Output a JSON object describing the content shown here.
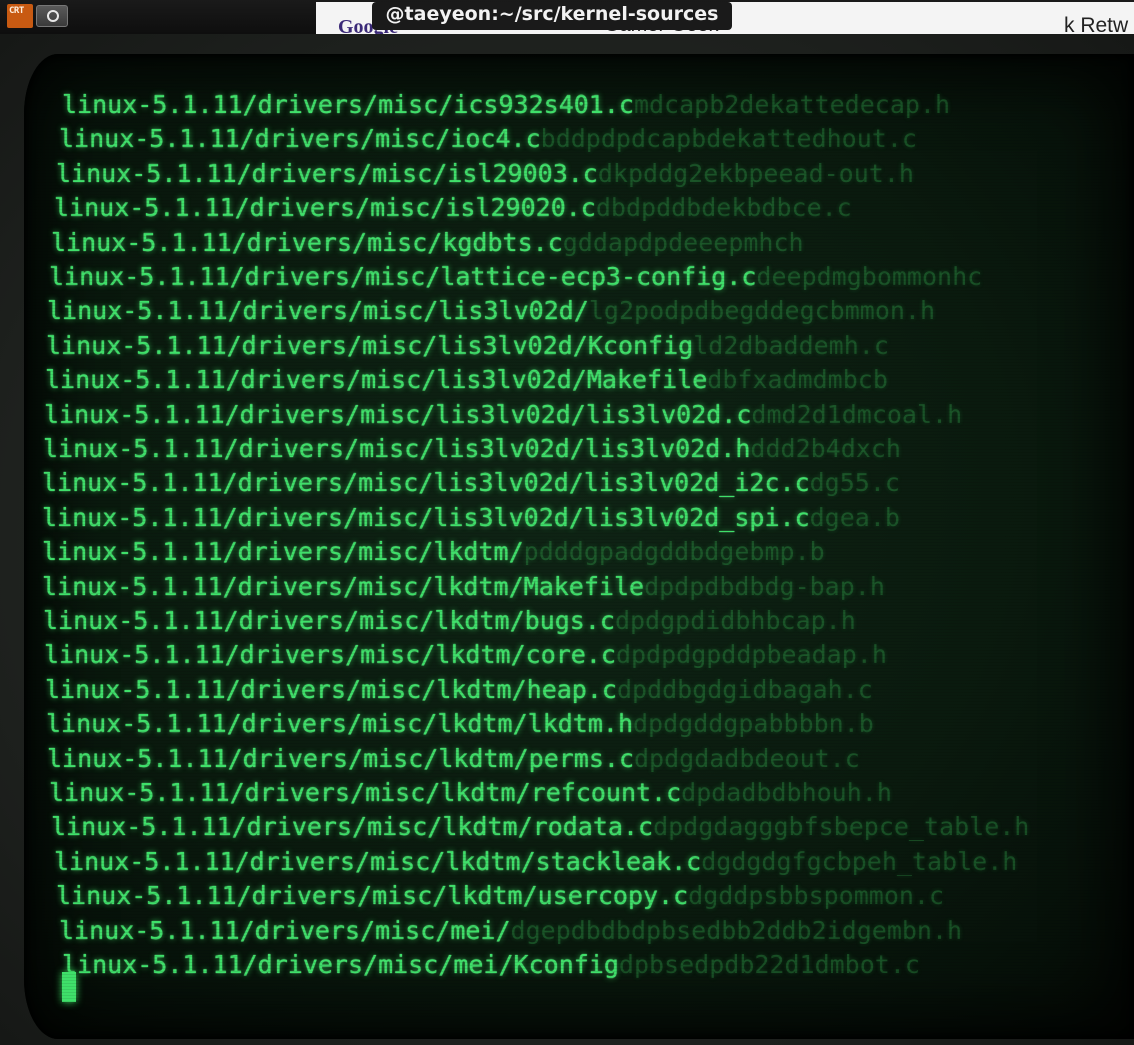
{
  "window": {
    "title": "@taeyeon:~/src/kernel-sources",
    "app_icon_label": "CRT",
    "app_icon": "crt-app-icon",
    "menu_icon": "circle-menu-icon",
    "background_window": {
      "logo_text": "Google",
      "heading_text": "Gamer Geek",
      "right_text": "k Retw"
    }
  },
  "colors": {
    "phosphor": "#3fe06a",
    "screen": "#0a1a0e",
    "titlebar": "#111111"
  },
  "terminal": {
    "lines": [
      {
        "text": "linux-5.1.11/drivers/misc/ics932s401.c",
        "ghost": "mdcapb2dekattedecap.h"
      },
      {
        "text": "linux-5.1.11/drivers/misc/ioc4.c",
        "ghost": "bddpdpdcapbdekattedhout.c"
      },
      {
        "text": "linux-5.1.11/drivers/misc/isl29003.c",
        "ghost": "dkpddg2ekbpeead-out.h"
      },
      {
        "text": "linux-5.1.11/drivers/misc/isl29020.c",
        "ghost": "dbdpddbdekbdbce.c"
      },
      {
        "text": "linux-5.1.11/drivers/misc/kgdbts.c",
        "ghost": "gddapdpdeeepmhch"
      },
      {
        "text": "linux-5.1.11/drivers/misc/lattice-ecp3-config.c",
        "ghost": "deepdmgbommonhc"
      },
      {
        "text": "linux-5.1.11/drivers/misc/lis3lv02d/",
        "ghost": "lg2podpdbegddegcbmmon.h"
      },
      {
        "text": "linux-5.1.11/drivers/misc/lis3lv02d/Kconfig",
        "ghost": "ld2dbaddemh.c"
      },
      {
        "text": "linux-5.1.11/drivers/misc/lis3lv02d/Makefile",
        "ghost": "dbfxadmdmbcb"
      },
      {
        "text": "linux-5.1.11/drivers/misc/lis3lv02d/lis3lv02d.c",
        "ghost": "dmd2d1dmcoal.h"
      },
      {
        "text": "linux-5.1.11/drivers/misc/lis3lv02d/lis3lv02d.h",
        "ghost": "ddd2b4dxch"
      },
      {
        "text": "linux-5.1.11/drivers/misc/lis3lv02d/lis3lv02d_i2c.c",
        "ghost": "dg55.c"
      },
      {
        "text": "linux-5.1.11/drivers/misc/lis3lv02d/lis3lv02d_spi.c",
        "ghost": "dgea.b"
      },
      {
        "text": "linux-5.1.11/drivers/misc/lkdtm/",
        "ghost": "pdddgpadgddbdgebmp.b"
      },
      {
        "text": "linux-5.1.11/drivers/misc/lkdtm/Makefile",
        "ghost": "dpdpdbdbdg-bap.h"
      },
      {
        "text": "linux-5.1.11/drivers/misc/lkdtm/bugs.c",
        "ghost": "dpdgpdidbhbcap.h"
      },
      {
        "text": "linux-5.1.11/drivers/misc/lkdtm/core.c",
        "ghost": "dpdpdgpddpbeadap.h"
      },
      {
        "text": "linux-5.1.11/drivers/misc/lkdtm/heap.c",
        "ghost": "dpddbgdgidbagah.c"
      },
      {
        "text": "linux-5.1.11/drivers/misc/lkdtm/lkdtm.h",
        "ghost": "dpdgddgpabbbbn.b"
      },
      {
        "text": "linux-5.1.11/drivers/misc/lkdtm/perms.c",
        "ghost": "dpdgdadbdeout.c"
      },
      {
        "text": "linux-5.1.11/drivers/misc/lkdtm/refcount.c",
        "ghost": "dpdadbdbhouh.h"
      },
      {
        "text": "linux-5.1.11/drivers/misc/lkdtm/rodata.c",
        "ghost": "dpdgdagggbfsbepce_table.h"
      },
      {
        "text": "linux-5.1.11/drivers/misc/lkdtm/stackleak.c",
        "ghost": "dgdgdgfgcbpeh_table.h"
      },
      {
        "text": "linux-5.1.11/drivers/misc/lkdtm/usercopy.c",
        "ghost": "dgddpsbbspommon.c"
      },
      {
        "text": "linux-5.1.11/drivers/misc/mei/",
        "ghost": "dgepdbdbdpbsedbb2ddb2idgembn.h"
      },
      {
        "text": "linux-5.1.11/drivers/misc/mei/Kconfig",
        "ghost": "dpbsedpdb22d1dmbot.c"
      }
    ]
  }
}
